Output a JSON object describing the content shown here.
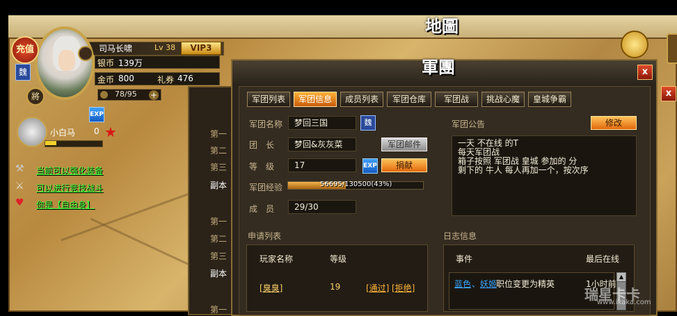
{
  "map": {
    "title": "地圖"
  },
  "player": {
    "recharge_label": "充值",
    "faction": "魏",
    "rank": "將",
    "name": "司马长啸",
    "level": "Lv 38",
    "vip": "VIP3",
    "silver_label": "银币",
    "silver_value": "139万",
    "gold_label": "金币",
    "gold_value": "800",
    "coupon_label": "礼券",
    "coupon_value": "476",
    "energy": "78/95",
    "exp_icon": "EXP"
  },
  "mount": {
    "name": "小白马",
    "count": "0",
    "progress": 0.2
  },
  "quests": [
    {
      "text": "当前可以强化装备",
      "icon": "anvil-icon"
    },
    {
      "text": "可以进行竞技战斗",
      "icon": "swords-icon"
    },
    {
      "text": "你是【自由身】",
      "icon": "heart-icon"
    }
  ],
  "back_list": {
    "rows": [
      "第一",
      "第二",
      "第三",
      "副本",
      "第一",
      "第二",
      "第三",
      "副本",
      "第一"
    ]
  },
  "dialog": {
    "title": "軍團",
    "close": "x",
    "tabs": [
      "军团列表",
      "军团信息",
      "成员列表",
      "军团仓库",
      "军团战",
      "挑战心魔",
      "皇城争霸"
    ],
    "active_tab": 1,
    "fields": {
      "name_label": "军团名称",
      "name_value": "梦回三国",
      "faction_badge": "魏",
      "leader_label": "团　长",
      "leader_value": "梦回&灰灰菜",
      "mail_button": "军团邮件",
      "level_label": "等　级",
      "level_value": "17",
      "donate_button": "捐献",
      "exp_label": "军团经验",
      "exp_text": "56695/130500(43%)",
      "exp_fraction": 0.43,
      "members_label": "成　员",
      "members_value": "29/30"
    },
    "notice": {
      "label": "军团公告",
      "edit_button": "修改",
      "lines": [
        "一天 不在线 的T",
        "每天军团战",
        "箱子按照 军团战  皇城 参加的 分",
        "剩下的 牛人 每人再加一个，按次序"
      ]
    },
    "applications": {
      "title": "申请列表",
      "col_name": "玩家名称",
      "col_level": "等级",
      "rows": [
        {
          "name": "[臭臭]",
          "level": "19",
          "approve": "[通过]",
          "reject": "[拒绝]"
        }
      ]
    },
    "log": {
      "title": "日志信息",
      "col_event": "事件",
      "col_time": "最后在线",
      "rows": [
        {
          "name1": "蓝色",
          "sep": "、",
          "name2": "妖姬",
          "event": "职位变更为精英",
          "time": "1小时前"
        }
      ]
    }
  },
  "watermark": {
    "brand": "瑞星卡卡",
    "url": "www.ikaka.com"
  },
  "colors": {
    "accent_orange": "#e2680c",
    "link_green": "#3cff3c",
    "link_blue": "#3aa6ff",
    "gold": "#ffd36a"
  }
}
